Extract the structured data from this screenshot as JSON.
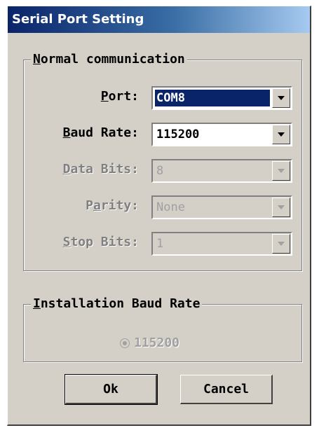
{
  "window": {
    "title": "Serial Port Setting"
  },
  "normal": {
    "legend_first": "N",
    "legend_rest": "ormal communication",
    "rows": [
      {
        "label_pre": "",
        "label_ul": "P",
        "label_post": "ort:",
        "value": "COM8",
        "enabled": true
      },
      {
        "label_pre": "",
        "label_ul": "B",
        "label_post": "aud Rate:",
        "value": "115200",
        "enabled": true
      },
      {
        "label_pre": "",
        "label_ul": "D",
        "label_post": "ata Bits:",
        "value": "8",
        "enabled": false
      },
      {
        "label_pre": "P",
        "label_ul": "a",
        "label_post": "rity:",
        "value": "None",
        "enabled": false
      },
      {
        "label_pre": "",
        "label_ul": "S",
        "label_post": "top Bits:",
        "value": "1",
        "enabled": false
      }
    ]
  },
  "install": {
    "legend_first": "I",
    "legend_rest": "nstallation Baud Rate",
    "option_label": "115200",
    "option_selected": true,
    "enabled": false
  },
  "buttons": {
    "ok": "Ok",
    "cancel": "Cancel"
  },
  "icons": {
    "dropdown": "chevron-down-icon",
    "radio": "radio-button-icon"
  },
  "colors": {
    "title_start": "#0a246a",
    "title_end": "#a6caf0",
    "face": "#d4d0c8",
    "selection": "#0a246a"
  }
}
